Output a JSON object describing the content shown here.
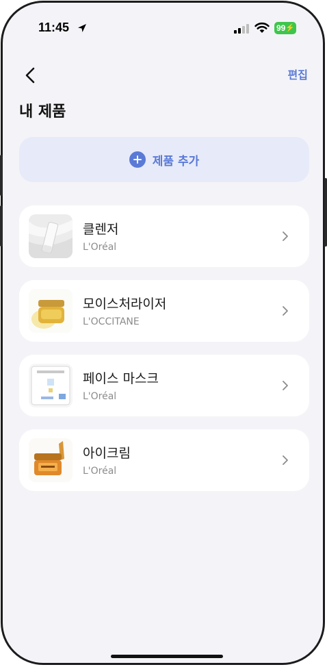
{
  "status_bar": {
    "time": "11:45",
    "battery": "99"
  },
  "nav": {
    "edit_label": "편집"
  },
  "page": {
    "title": "내 제품"
  },
  "add_button": {
    "label": "제품 추가"
  },
  "products": [
    {
      "name": "클렌저",
      "brand": "L'Oréal",
      "thumb_icon": "cleanser-tube-icon"
    },
    {
      "name": "모이스처라이저",
      "brand": "L'OCCITANE",
      "thumb_icon": "cream-jar-icon"
    },
    {
      "name": "페이스 마스크",
      "brand": "L'Oréal",
      "thumb_icon": "sheet-mask-icon"
    },
    {
      "name": "아이크림",
      "brand": "L'Oréal",
      "thumb_icon": "eye-cream-jar-icon"
    }
  ],
  "colors": {
    "accent": "#5a7ad6",
    "background": "#f4f4f8",
    "card": "#ffffff",
    "battery": "#3ec64c"
  }
}
